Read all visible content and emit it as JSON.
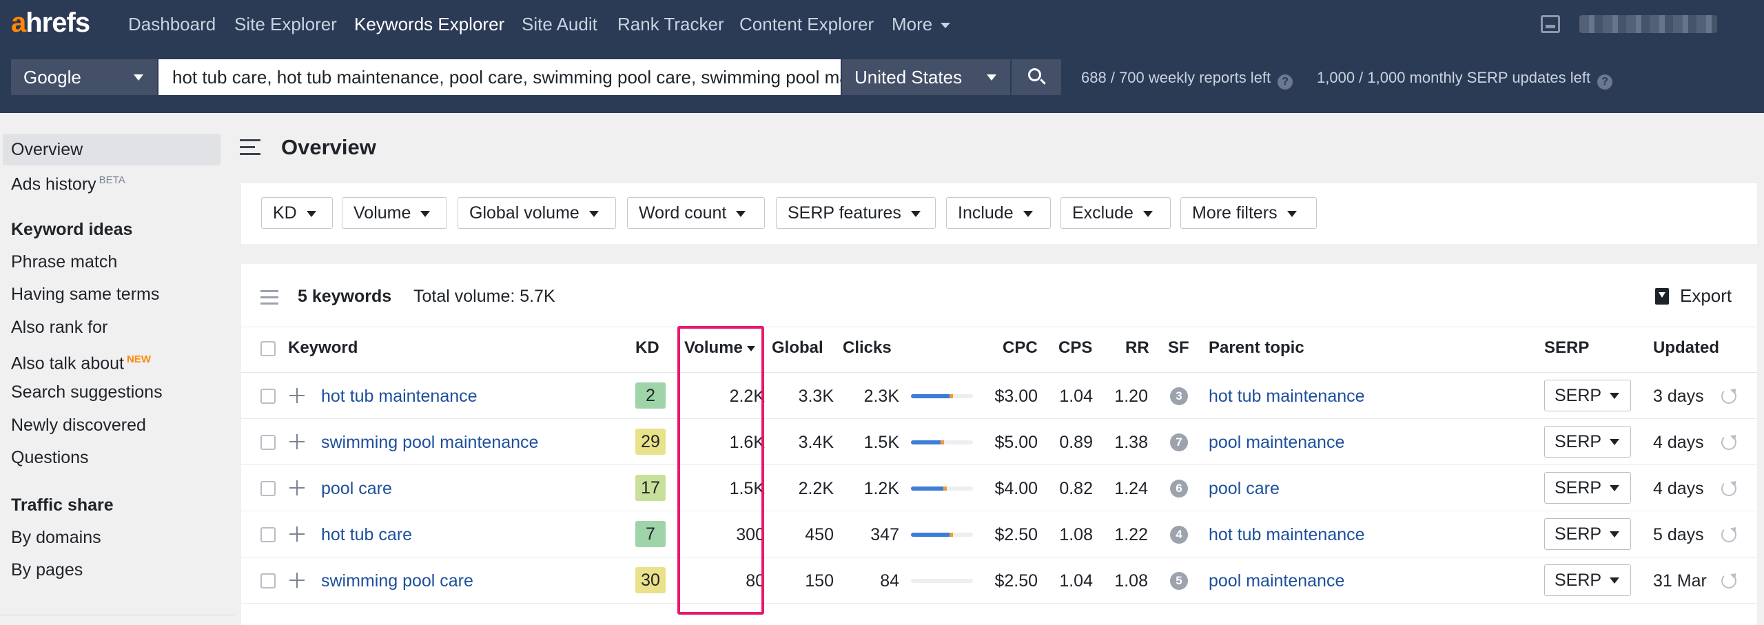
{
  "logo": {
    "first": "a",
    "rest": "hrefs"
  },
  "nav": {
    "items": [
      "Dashboard",
      "Site Explorer",
      "Keywords Explorer",
      "Site Audit",
      "Rank Tracker",
      "Content Explorer",
      "More"
    ],
    "active": "Keywords Explorer"
  },
  "search": {
    "engine": "Google",
    "keywords": "hot tub care, hot tub maintenance, pool care, swimming pool care, swimming pool maintenance",
    "country": "United States",
    "weekly_reports": "688 / 700 weekly reports left",
    "serp_updates": "1,000 / 1,000 monthly SERP updates left",
    "help_glyph": "?"
  },
  "sidebar": {
    "top": [
      {
        "label": "Overview",
        "active": true
      },
      {
        "label": "Ads history",
        "sup": "BETA"
      }
    ],
    "keyword_ideas": {
      "heading": "Keyword ideas",
      "items": [
        {
          "label": "Phrase match"
        },
        {
          "label": "Having same terms"
        },
        {
          "label": "Also rank for"
        },
        {
          "label": "Also talk about",
          "sup": "NEW"
        },
        {
          "label": "Search suggestions"
        },
        {
          "label": "Newly discovered"
        },
        {
          "label": "Questions"
        }
      ]
    },
    "traffic_share": {
      "heading": "Traffic share",
      "items": [
        {
          "label": "By domains"
        },
        {
          "label": "By pages"
        }
      ]
    }
  },
  "main": {
    "title": "Overview",
    "filters": [
      "KD",
      "Volume",
      "Global volume",
      "Word count",
      "SERP features",
      "Include",
      "Exclude",
      "More filters"
    ],
    "summary": {
      "count": "5 keywords",
      "total_volume": "Total volume: 5.7K"
    },
    "export_label": "Export"
  },
  "table": {
    "headers": {
      "keyword": "Keyword",
      "kd": "KD",
      "volume": "Volume",
      "global": "Global",
      "clicks": "Clicks",
      "cpc": "CPC",
      "cps": "CPS",
      "rr": "RR",
      "sf": "SF",
      "parent_topic": "Parent topic",
      "serp": "SERP",
      "updated": "Updated"
    },
    "serp_button_label": "SERP",
    "rows": [
      {
        "keyword": "hot tub maintenance",
        "kd": "2",
        "kd_color": "#9fd4a8",
        "volume": "2.2K",
        "global": "3.3K",
        "clicks": "2.3K",
        "organic_share": 0.62,
        "paid_share": 0.06,
        "cpc": "$3.00",
        "cps": "1.04",
        "rr": "1.20",
        "sf": "3",
        "parent_topic": "hot tub maintenance",
        "updated": "3 days"
      },
      {
        "keyword": "swimming pool maintenance",
        "kd": "29",
        "kd_color": "#e9e28a",
        "volume": "1.6K",
        "global": "3.4K",
        "clicks": "1.5K",
        "organic_share": 0.48,
        "paid_share": 0.06,
        "cpc": "$5.00",
        "cps": "0.89",
        "rr": "1.38",
        "sf": "7",
        "parent_topic": "pool maintenance",
        "updated": "4 days"
      },
      {
        "keyword": "pool care",
        "kd": "17",
        "kd_color": "#c8e09a",
        "volume": "1.5K",
        "global": "2.2K",
        "clicks": "1.2K",
        "organic_share": 0.52,
        "paid_share": 0.05,
        "cpc": "$4.00",
        "cps": "0.82",
        "rr": "1.24",
        "sf": "6",
        "parent_topic": "pool care",
        "updated": "4 days"
      },
      {
        "keyword": "hot tub care",
        "kd": "7",
        "kd_color": "#9fd4a8",
        "volume": "300",
        "global": "450",
        "clicks": "347",
        "organic_share": 0.62,
        "paid_share": 0.05,
        "cpc": "$2.50",
        "cps": "1.08",
        "rr": "1.22",
        "sf": "4",
        "parent_topic": "hot tub maintenance",
        "updated": "5 days"
      },
      {
        "keyword": "swimming pool care",
        "kd": "30",
        "kd_color": "#e9e28a",
        "volume": "80",
        "global": "150",
        "clicks": "84",
        "organic_share": 0.0,
        "paid_share": 0.0,
        "cpc": "$2.50",
        "cps": "1.04",
        "rr": "1.08",
        "sf": "5",
        "parent_topic": "pool maintenance",
        "updated": "31 Mar"
      }
    ]
  },
  "colors": {
    "nav_bg": "#2b3a55",
    "link": "#1d4f9c",
    "accent": "#ff8800",
    "highlight": "#e6196e"
  }
}
